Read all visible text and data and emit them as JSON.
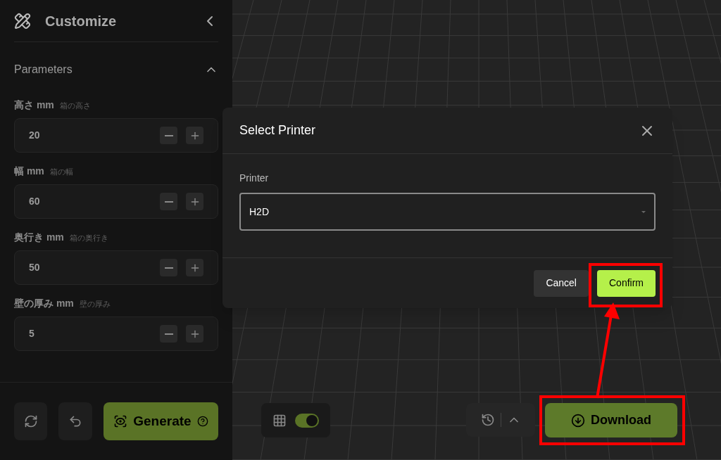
{
  "sidebar": {
    "title": "Customize",
    "section": {
      "title": "Parameters",
      "expanded": true
    },
    "parameters": [
      {
        "label": "高さ mm",
        "hint": "箱の高さ",
        "value": "20"
      },
      {
        "label": "幅 mm",
        "hint": "箱の幅",
        "value": "60"
      },
      {
        "label": "奥行き mm",
        "hint": "箱の奥行き",
        "value": "50"
      },
      {
        "label": "壁の厚み mm",
        "hint": "壁の厚み",
        "value": "5"
      }
    ],
    "generate_button": "Generate"
  },
  "viewport": {
    "grid_toggle": {
      "on": true
    },
    "download_button": "Download"
  },
  "dialog": {
    "title": "Select Printer",
    "field_label": "Printer",
    "value": "H2D",
    "buttons": [
      {
        "label": "Cancel",
        "kind": "secondary"
      },
      {
        "label": "Confirm",
        "kind": "primary"
      }
    ]
  }
}
